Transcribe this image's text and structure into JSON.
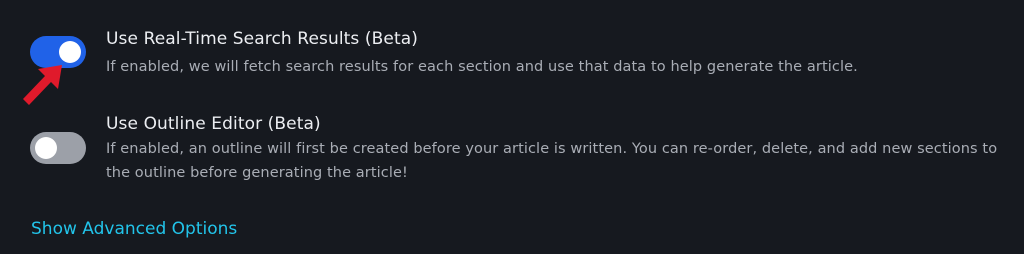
{
  "settings": [
    {
      "title": "Use Real-Time Search Results (Beta)",
      "description": "If enabled, we will fetch search results for each section and use that data to help generate the article.",
      "enabled": true
    },
    {
      "title": "Use Outline Editor (Beta)",
      "description": "If enabled, an outline will first be created before your article is written. You can re-order, delete, and add new sections to the outline before generating the article!",
      "enabled": false
    }
  ],
  "advanced_link": {
    "label": "Show Advanced Options"
  },
  "colors": {
    "background": "#16191f",
    "toggle_on": "#2062e8",
    "toggle_off": "#9ca0a8",
    "link": "#22c4ea",
    "annotation_arrow": "#e01a2b"
  },
  "icons": {
    "annotation": "red-arrow-icon"
  }
}
